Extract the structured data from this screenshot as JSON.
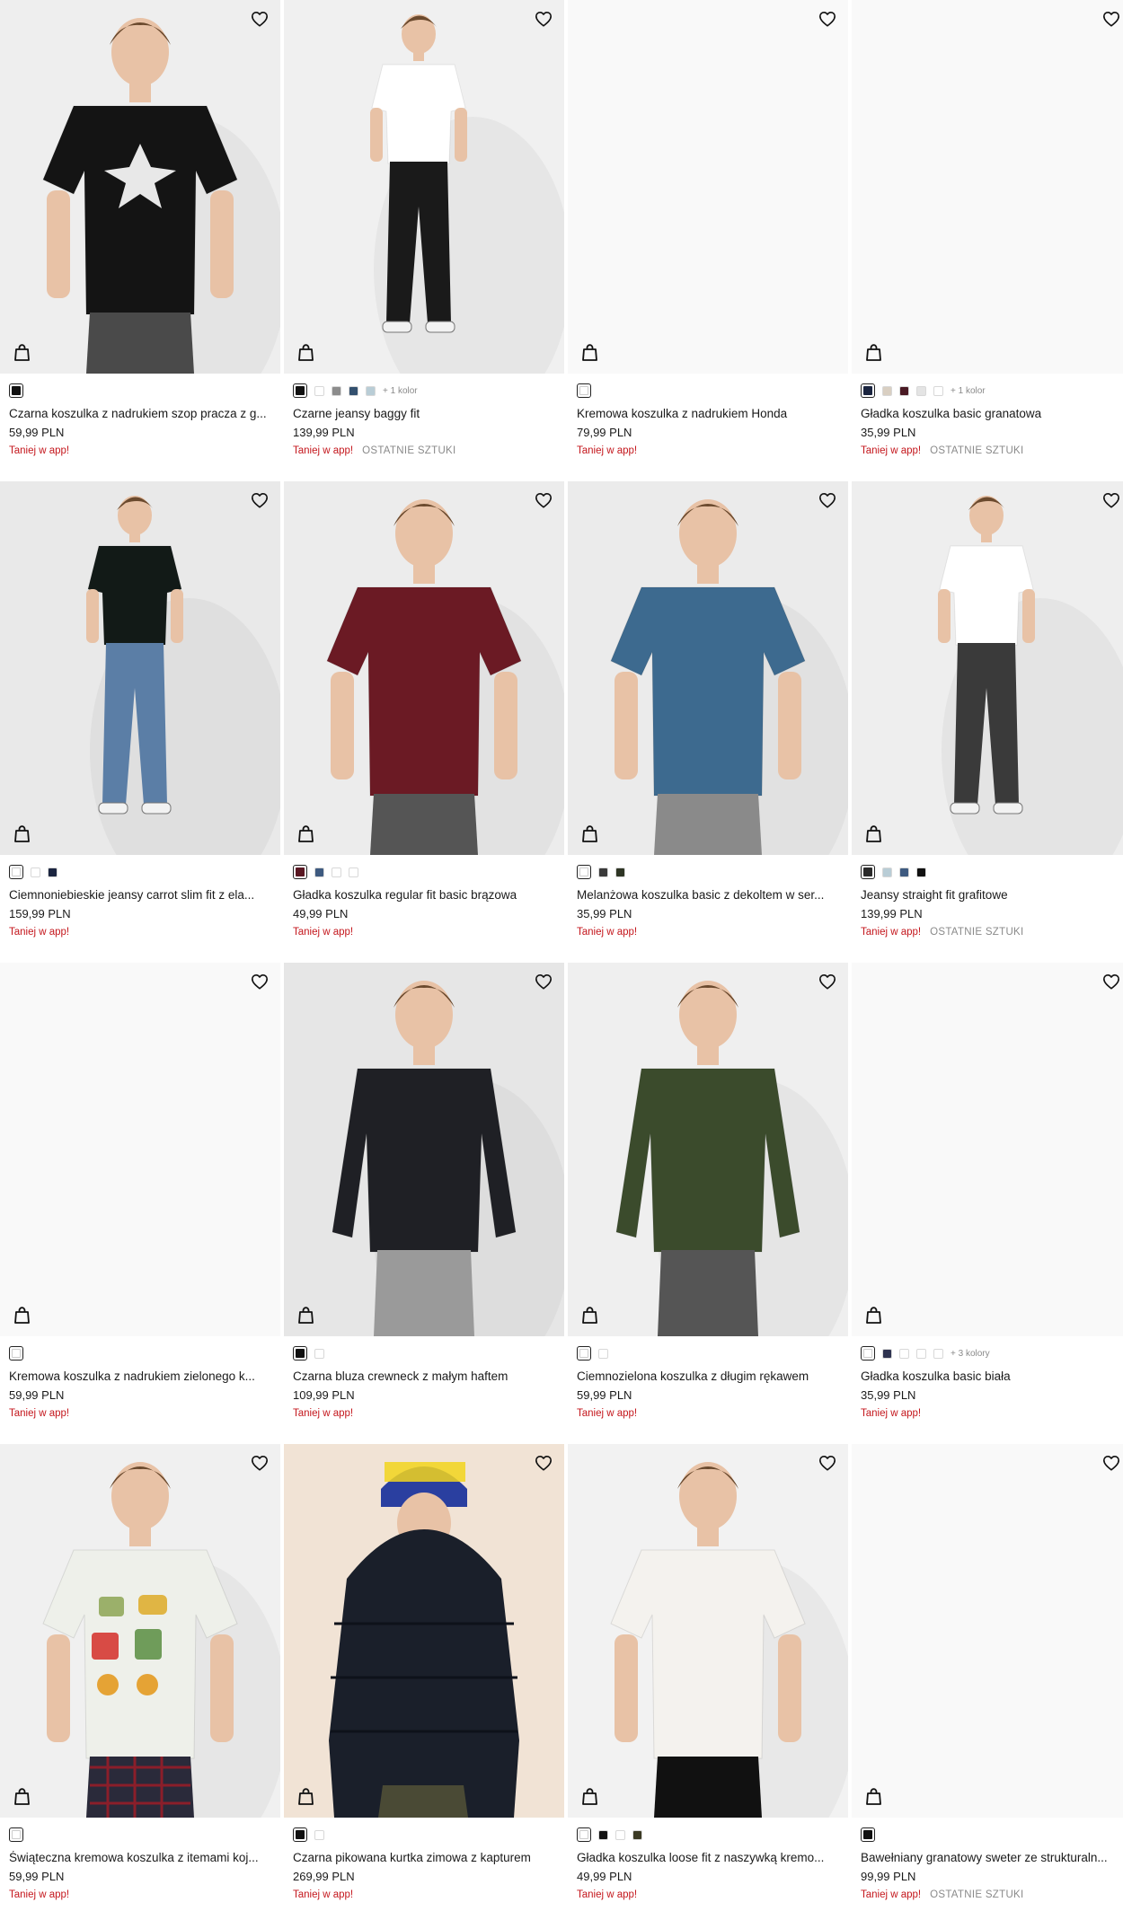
{
  "colors": {
    "promo": "#c4161c",
    "muted": "#8a8a8a"
  },
  "icons": {
    "wishlist": "heart-icon",
    "cart": "shopping-bag-icon"
  },
  "products": [
    {
      "name": "Czarna koszulka z nadrukiem szop pracza z g...",
      "price": "59,99 PLN",
      "promo": "Taniej w app!",
      "badge": "",
      "swatches": [
        "#111111"
      ],
      "more": "",
      "image": "tee-print",
      "shirt": "#141414",
      "pants": "#4a4a4a",
      "bg": "#eeeeee"
    },
    {
      "name": "Czarne jeansy baggy fit",
      "price": "139,99 PLN",
      "promo": "Taniej w app!",
      "badge": "OSTATNIE SZTUKI",
      "swatches": [
        "#111111",
        "#ffffff",
        "#8c8c8c",
        "#33506e",
        "#b9cdd6"
      ],
      "more": "+ 1 kolor",
      "image": "full-body",
      "shirt": "#ffffff",
      "pants": "#1a1a1a",
      "bg": "#f0f0f0"
    },
    {
      "name": "Kremowa koszulka z nadrukiem Honda",
      "price": "79,99 PLN",
      "promo": "Taniej w app!",
      "badge": "",
      "swatches": [
        "#ffffff"
      ],
      "more": "",
      "image": "blank"
    },
    {
      "name": "Gładka koszulka basic granatowa",
      "price": "35,99 PLN",
      "promo": "Taniej w app!",
      "badge": "OSTATNIE SZTUKI",
      "swatches": [
        "#1b2540",
        "#d9cfc2",
        "#4a1a24",
        "#e4e4e4",
        "#ffffff"
      ],
      "more": "+ 1 kolor",
      "image": "blank"
    },
    {
      "name": "Ciemnoniebieskie jeansy carrot slim fit z ela...",
      "price": "159,99 PLN",
      "promo": "Taniej w app!",
      "badge": "",
      "swatches": [
        "#ffffff",
        "#ffffff",
        "#1b2540"
      ],
      "more": "",
      "image": "full-body",
      "shirt": "#121a17",
      "pants": "#5b7ea6",
      "bg": "#e9e9e9"
    },
    {
      "name": "Gładka koszulka regular fit basic brązowa",
      "price": "49,99 PLN",
      "promo": "Taniej w app!",
      "badge": "",
      "swatches": [
        "#5a1722",
        "#3e5a80",
        "#ffffff",
        "#ffffff"
      ],
      "more": "",
      "image": "tee",
      "shirt": "#6b1a24",
      "pants": "#555555",
      "bg": "#ececec"
    },
    {
      "name": "Melanżowa koszulka basic z dekoltem w ser...",
      "price": "35,99 PLN",
      "promo": "Taniej w app!",
      "badge": "",
      "swatches": [
        "#ffffff",
        "#3a3a3a",
        "#2e3524"
      ],
      "more": "",
      "image": "tee",
      "shirt": "#3d6a8f",
      "pants": "#8a8a8a",
      "bg": "#ebebeb"
    },
    {
      "name": "Jeansy straight fit grafitowe",
      "price": "139,99 PLN",
      "promo": "Taniej w app!",
      "badge": "OSTATNIE SZTUKI",
      "swatches": [
        "#2b2b2b",
        "#b9cdd6",
        "#3e5a80",
        "#111111"
      ],
      "more": "",
      "image": "full-body",
      "shirt": "#ffffff",
      "pants": "#3a3a3a",
      "bg": "#eeeeee"
    },
    {
      "name": "Kremowa koszulka z nadrukiem zielonego k...",
      "price": "59,99 PLN",
      "promo": "Taniej w app!",
      "badge": "",
      "swatches": [
        "#ffffff"
      ],
      "more": "",
      "image": "blank"
    },
    {
      "name": "Czarna bluza crewneck z małym haftem",
      "price": "109,99 PLN",
      "promo": "Taniej w app!",
      "badge": "",
      "swatches": [
        "#111111",
        "#ffffff"
      ],
      "more": "",
      "image": "longsleeve",
      "shirt": "#1f2025",
      "pants": "#9a9a9a",
      "bg": "#e6e6e6"
    },
    {
      "name": "Ciemnozielona koszulka z długim rękawem",
      "price": "59,99 PLN",
      "promo": "Taniej w app!",
      "badge": "",
      "swatches": [
        "#ffffff",
        "#ffffff"
      ],
      "more": "",
      "image": "longsleeve",
      "shirt": "#3b4b2c",
      "pants": "#555555",
      "bg": "#efefef"
    },
    {
      "name": "Gładka koszulka basic biała",
      "price": "35,99 PLN",
      "promo": "Taniej w app!",
      "badge": "",
      "swatches": [
        "#ffffff",
        "#2e3350",
        "#ffffff",
        "#ffffff",
        "#ffffff"
      ],
      "more": "+ 3 kolory",
      "image": "blank"
    },
    {
      "name": "Świąteczna kremowa koszulka z itemami koj...",
      "price": "59,99 PLN",
      "promo": "Taniej w app!",
      "badge": "",
      "swatches": [
        "#ffffff"
      ],
      "more": "",
      "image": "tee-print2",
      "shirt": "#eef0ea",
      "pants": "#2a2a3a",
      "bg": "#f0f0f0"
    },
    {
      "name": "Czarna pikowana kurtka zimowa z kapturem",
      "price": "269,99 PLN",
      "promo": "Taniej w app!",
      "badge": "",
      "swatches": [
        "#111111",
        "#ffffff"
      ],
      "more": "",
      "image": "jacket",
      "shirt": "#1a1f2a",
      "pants": "#4a4a35",
      "bg": "#efe2d6"
    },
    {
      "name": "Gładka koszulka loose fit z naszywką kremo...",
      "price": "49,99 PLN",
      "promo": "Taniej w app!",
      "badge": "",
      "swatches": [
        "#ffffff",
        "#111111",
        "#ffffff",
        "#3b3a24"
      ],
      "more": "",
      "image": "tee",
      "shirt": "#f4f2ee",
      "pants": "#111111",
      "bg": "#f2f2f2"
    },
    {
      "name": "Bawełniany granatowy sweter ze strukturaln...",
      "price": "99,99 PLN",
      "promo": "Taniej w app!",
      "badge": "OSTATNIE SZTUKI",
      "swatches": [
        "#111111"
      ],
      "more": "",
      "image": "blank"
    }
  ]
}
